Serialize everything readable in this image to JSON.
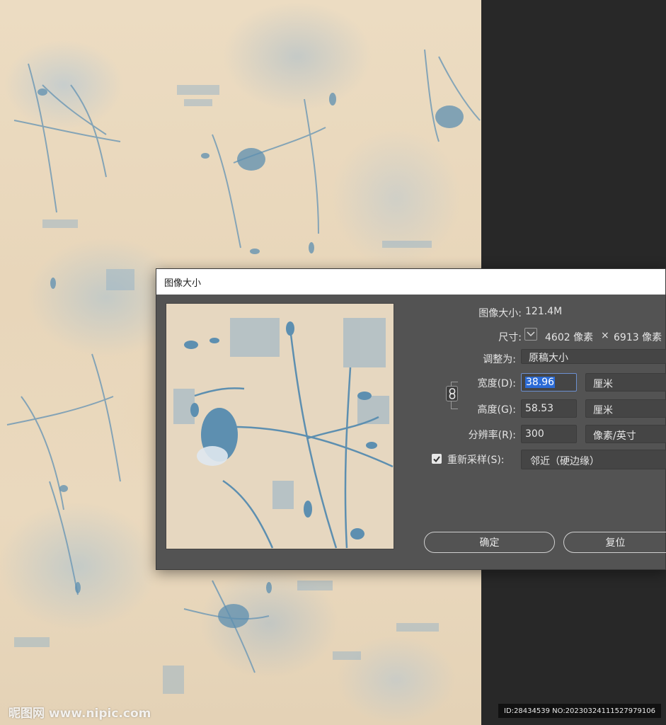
{
  "dialog": {
    "title": "图像大小",
    "image_size_label": "图像大小:",
    "image_size_value": "121.4M",
    "dimensions_label": "尺寸:",
    "dimensions_width": "4602 像素",
    "dimensions_sep": "×",
    "dimensions_height": "6913 像素",
    "fit_to_label": "调整为:",
    "fit_to_value": "原稿大小",
    "width_label": "宽度(D):",
    "width_value": "38.96",
    "width_unit": "厘米",
    "height_label": "高度(G):",
    "height_value": "58.53",
    "height_unit": "厘米",
    "resolution_label": "分辨率(R):",
    "resolution_value": "300",
    "resolution_unit": "像素/英寸",
    "resample_label": "重新采样(S):",
    "resample_checked": true,
    "resample_method": "邻近（硬边缘）",
    "ok_label": "确定",
    "reset_label": "复位"
  },
  "watermark": "昵图网 www.nipic.com",
  "id_text": "ID:28434539 NO:20230324111527979106",
  "colors": {
    "dialog_bg": "#535353",
    "field_bg": "#454545",
    "selection": "#2b6bd6",
    "canvas_beige": "#e8d6ba",
    "motif_blue": "#5d8fb0"
  }
}
